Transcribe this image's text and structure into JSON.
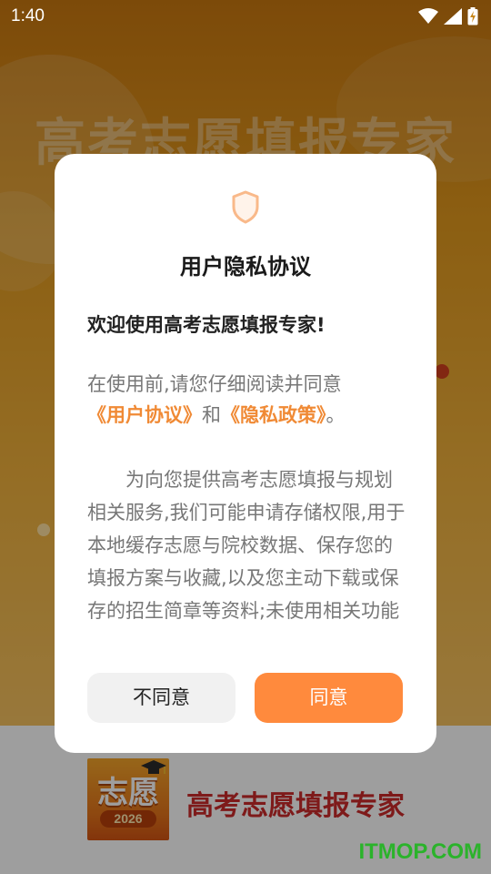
{
  "status_bar": {
    "time": "1:40",
    "icons": [
      "wifi-icon",
      "cellular-signal-icon",
      "battery-charging-icon"
    ]
  },
  "background": {
    "title": "高考志愿填报专家"
  },
  "dialog": {
    "icon": "shield-icon",
    "title": "用户隐私协议",
    "welcome": "欢迎使用高考志愿填报专家!",
    "intro_prefix": "在使用前,请您仔细阅读并同意",
    "user_agreement_link": "《用户协议》",
    "conjunction": "和",
    "privacy_policy_link": "《隐私政策》",
    "intro_suffix": "。",
    "policy_text": "为向您提供高考志愿填报与规划相关服务,我们可能申请存储权限,用于本地缓存志愿与院校数据、保存您的填报方案与收藏,以及您主动下载或保存的招生简章等资料;未使用相关功能",
    "disagree_label": "不同意",
    "agree_label": "同意"
  },
  "footer": {
    "logo_text": "志愿",
    "logo_year": "2026",
    "app_name": "高考志愿填报专家"
  },
  "watermark": "ITMOP.COM",
  "colors": {
    "accent": "#ff8a3d",
    "link": "#f08a35",
    "brand_red": "#cc2b2b"
  }
}
